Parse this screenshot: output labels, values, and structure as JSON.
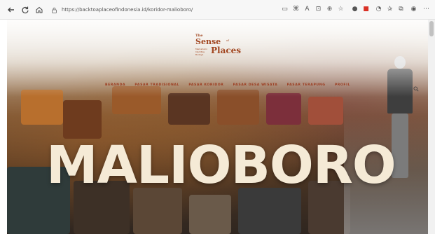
{
  "browser": {
    "url": "https://backtoaplaceofindonesia.id/koridor-malioboro/",
    "back_icon": "arrow-left-icon",
    "forward_icon": "arrow-right-icon",
    "reload_icon": "reload-icon",
    "home_icon": "home-icon"
  },
  "site": {
    "logo": {
      "the": "The",
      "sense": "Sense",
      "of": "of",
      "places": "Places",
      "tagline": "Memahami Identitas Budaya"
    },
    "nav": [
      "BERANDA",
      "PASAR TRADISIONAL",
      "PASAR KORIDOR",
      "PASAR DESA WISATA",
      "PASAR TERAPUNG",
      "PROFIL"
    ],
    "hero_title": "MALIOBORO",
    "colors": {
      "brand": "#a1451f",
      "nav": "#9c3b1f",
      "title": "#f5ead6"
    }
  }
}
